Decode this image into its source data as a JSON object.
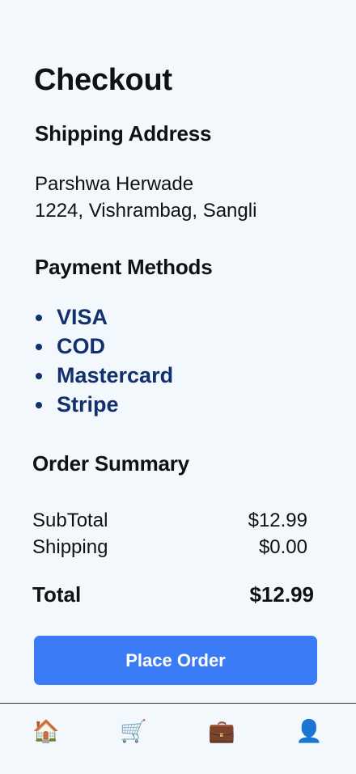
{
  "page": {
    "title": "Checkout"
  },
  "shipping": {
    "heading": "Shipping Address",
    "name": "Parshwa Herwade",
    "address": "1224, Vishrambag, Sangli"
  },
  "payment": {
    "heading": "Payment Methods",
    "methods": [
      "VISA",
      "COD",
      "Mastercard",
      "Stripe"
    ]
  },
  "summary": {
    "heading": "Order Summary",
    "subtotal_label": "SubTotal",
    "subtotal_value": "$12.99",
    "shipping_label": "Shipping",
    "shipping_value": "$0.00",
    "total_label": "Total",
    "total_value": "$12.99"
  },
  "actions": {
    "place_order_label": "Place Order"
  },
  "tabbar": {
    "items": [
      {
        "icon": "home-icon",
        "glyph": "🏠"
      },
      {
        "icon": "cart-icon",
        "glyph": "🛒"
      },
      {
        "icon": "briefcase-icon",
        "glyph": "💼"
      },
      {
        "icon": "profile-icon",
        "glyph": "👤"
      }
    ]
  }
}
